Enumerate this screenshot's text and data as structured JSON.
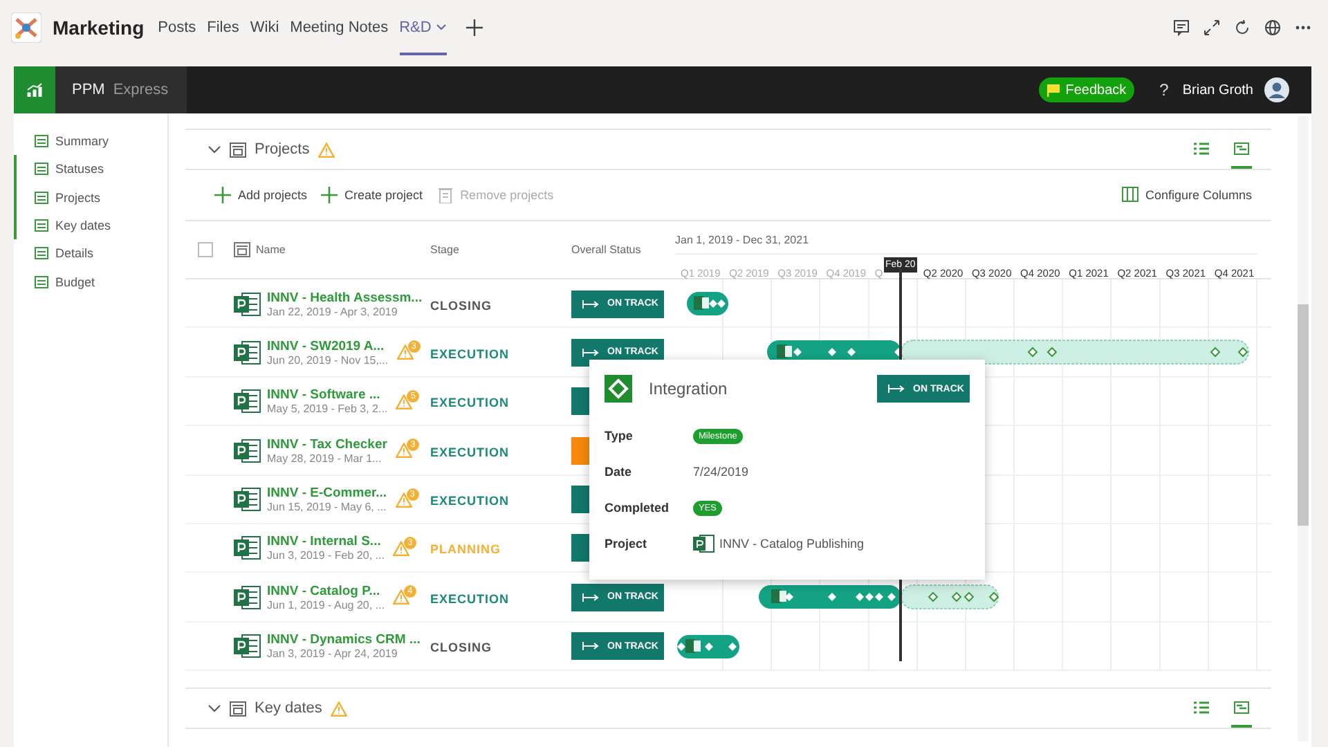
{
  "teams_bar": {
    "team": "Marketing",
    "tabs": [
      {
        "label": "Posts",
        "selected": false,
        "dropdown": false
      },
      {
        "label": "Files",
        "selected": false,
        "dropdown": false
      },
      {
        "label": "Wiki",
        "selected": false,
        "dropdown": false
      },
      {
        "label": "Meeting Notes",
        "selected": false,
        "dropdown": false
      },
      {
        "label": "R&D",
        "selected": true,
        "dropdown": true
      }
    ]
  },
  "app_header": {
    "product": "PPM",
    "edition": "Express",
    "feedback": "Feedback",
    "help": "?",
    "user": "Brian Groth"
  },
  "sidebar": {
    "items": [
      {
        "label": "Summary",
        "in_view": false
      },
      {
        "label": "Statuses",
        "in_view": true
      },
      {
        "label": "Projects",
        "in_view": true
      },
      {
        "label": "Key dates",
        "in_view": true
      },
      {
        "label": "Details",
        "in_view": false
      },
      {
        "label": "Budget",
        "in_view": false
      }
    ]
  },
  "projects_section": {
    "title": "Projects",
    "warning": true,
    "expanded": true,
    "views": [
      {
        "kind": "list",
        "selected": false
      },
      {
        "kind": "timeline",
        "selected": true
      }
    ],
    "toolbar": [
      {
        "label": "Add projects",
        "kind": "add",
        "disabled": false
      },
      {
        "label": "Create project",
        "kind": "add",
        "disabled": false
      },
      {
        "label": "Remove projects",
        "kind": "remove",
        "disabled": true
      },
      {
        "label": "Configure Columns",
        "kind": "columns",
        "disabled": false
      }
    ],
    "columns": {
      "select_all": {
        "checked": false
      },
      "name": "Name",
      "stage": "Stage",
      "status": "Overall Status",
      "range": "Jan 1, 2019 - Dec 31, 2021"
    },
    "quarters": [
      {
        "label": "Q1 2019",
        "past": true
      },
      {
        "label": "Q2 2019",
        "past": true
      },
      {
        "label": "Q3 2019",
        "past": true
      },
      {
        "label": "Q4 2019",
        "past": true
      },
      {
        "label": "Q",
        "past": true
      },
      {
        "label": "Q2 2020",
        "past": false
      },
      {
        "label": "Q3 2020",
        "past": false
      },
      {
        "label": "Q4 2020",
        "past": false
      },
      {
        "label": "Q1 2021",
        "past": false
      },
      {
        "label": "Q2 2021",
        "past": false
      },
      {
        "label": "Q3 2021",
        "past": false
      },
      {
        "label": "Q4 2021",
        "past": false
      }
    ],
    "today": "Feb 20",
    "rows": [
      {
        "name": "INNV - Health Assessm...",
        "dates": "Jan 22, 2019 - Apr 3, 2019",
        "stage": {
          "label": "CLOSING",
          "kind": "closing"
        },
        "status": {
          "color": "#12786b",
          "label": "ON TRACK"
        }
      },
      {
        "name": "INNV - SW2019 A...",
        "dates": "Jun 20, 2019 - Nov 15,...",
        "warnings": "3",
        "stage": {
          "label": "EXECUTION",
          "kind": "execution"
        },
        "status": {
          "color": "#12786b",
          "label": "ON TRACK"
        }
      },
      {
        "name": "INNV - Software ...",
        "dates": "May 5, 2019 - Feb 3, 2...",
        "warnings": "5",
        "stage": {
          "label": "EXECUTION",
          "kind": "execution"
        },
        "status": {
          "color": "#12786b"
        }
      },
      {
        "name": "INNV - Tax Checker",
        "dates": "May 28, 2019 - Mar 1...",
        "warnings": "3",
        "stage": {
          "label": "EXECUTION",
          "kind": "execution"
        },
        "status": {
          "color": "#f7890c"
        }
      },
      {
        "name": "INNV - E-Commer...",
        "dates": "Jun 15, 2019 - May 6, ...",
        "warnings": "3",
        "stage": {
          "label": "EXECUTION",
          "kind": "execution"
        },
        "status": {
          "color": "#12786b"
        }
      },
      {
        "name": "INNV - Internal S...",
        "dates": "Jun 3, 2019 - Feb 20, ...",
        "warnings": "3",
        "stage": {
          "label": "PLANNING",
          "kind": "planning"
        },
        "status": {
          "color": "#12786b"
        }
      },
      {
        "name": "INNV - Catalog P...",
        "dates": "Jun 1, 2019 - Aug 20, ...",
        "warnings": "4",
        "stage": {
          "label": "EXECUTION",
          "kind": "execution"
        },
        "status": {
          "color": "#12786b",
          "label": "ON TRACK"
        }
      },
      {
        "name": "INNV - Dynamics CRM ...",
        "dates": "Jan 3, 2019 - Apr 24, 2019",
        "stage": {
          "label": "CLOSING",
          "kind": "closing"
        },
        "status": {
          "color": "#12786b",
          "label": "ON TRACK"
        }
      }
    ],
    "tooltip": {
      "title": "Integration",
      "status": "ON TRACK",
      "fields": [
        {
          "label": "Type",
          "value": "Milestone",
          "kind": "pill"
        },
        {
          "label": "Date",
          "value": "7/24/2019",
          "kind": "text"
        },
        {
          "label": "Completed",
          "value": "YES",
          "kind": "pill"
        },
        {
          "label": "Project",
          "value": "INNV - Catalog Publishing",
          "kind": "project"
        }
      ]
    }
  },
  "key_dates_section": {
    "title": "Key dates",
    "warning": true,
    "expanded": true,
    "views": [
      {
        "kind": "list",
        "selected": false
      },
      {
        "kind": "timeline",
        "selected": true
      }
    ]
  }
}
